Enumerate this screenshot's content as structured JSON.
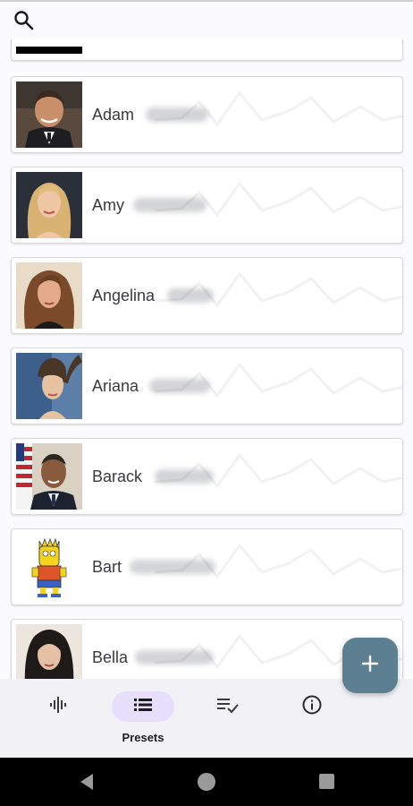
{
  "search": {
    "icon": "search-icon"
  },
  "contacts": [
    {
      "first_name": "Adam",
      "avatar": "portrait-man-dark-suit"
    },
    {
      "first_name": "Amy",
      "avatar": "portrait-woman-blonde"
    },
    {
      "first_name": "Angelina",
      "avatar": "portrait-woman-brunette"
    },
    {
      "first_name": "Ariana",
      "avatar": "portrait-woman-ponytail"
    },
    {
      "first_name": "Barack",
      "avatar": "portrait-man-flag-background"
    },
    {
      "first_name": "Bart",
      "avatar": "cartoon-character"
    },
    {
      "first_name": "Bella",
      "avatar": "portrait-woman-dark-hair"
    }
  ],
  "fab": {
    "icon": "plus-icon",
    "color": "#5d7f92"
  },
  "bottom_nav": {
    "items": [
      {
        "icon": "waveform-icon",
        "label": ""
      },
      {
        "icon": "list-icon",
        "label": "Presets",
        "active": true
      },
      {
        "icon": "playlist-check-icon",
        "label": ""
      },
      {
        "icon": "info-icon",
        "label": ""
      }
    ],
    "active_color": "#e7defc"
  },
  "system_nav": {
    "icons": [
      "back-icon",
      "home-icon",
      "recents-icon"
    ]
  }
}
